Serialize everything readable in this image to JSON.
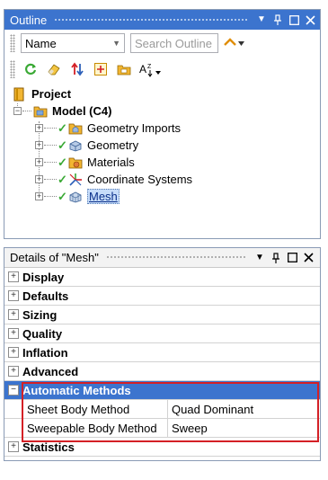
{
  "outline": {
    "title": "Outline",
    "name_filter": "Name",
    "search_placeholder": "Search Outline",
    "tree": [
      {
        "label": "Project",
        "icon": "project-icon",
        "bold": true
      },
      {
        "label": "Model (C4)",
        "icon": "model-icon",
        "bold": true
      },
      {
        "label": "Geometry Imports",
        "icon": "geometry-imports-icon"
      },
      {
        "label": "Geometry",
        "icon": "geometry-icon"
      },
      {
        "label": "Materials",
        "icon": "materials-icon"
      },
      {
        "label": "Coordinate Systems",
        "icon": "coordinate-systems-icon"
      },
      {
        "label": "Mesh",
        "icon": "mesh-icon",
        "selected": true
      }
    ]
  },
  "details": {
    "title": "Details of \"Mesh\"",
    "groups": [
      {
        "label": "Display",
        "expanded": false
      },
      {
        "label": "Defaults",
        "expanded": false
      },
      {
        "label": "Sizing",
        "expanded": false
      },
      {
        "label": "Quality",
        "expanded": false
      },
      {
        "label": "Inflation",
        "expanded": false
      },
      {
        "label": "Advanced",
        "expanded": false
      },
      {
        "label": "Automatic Methods",
        "expanded": true,
        "rows": [
          {
            "name": "Sheet Body Method",
            "value": "Quad Dominant"
          },
          {
            "name": "Sweepable Body Method",
            "value": "Sweep"
          }
        ]
      },
      {
        "label": "Statistics",
        "expanded": false
      }
    ]
  },
  "colors": {
    "accent": "#3c74ce",
    "highlight_border": "#d42026",
    "check": "#3aa935"
  }
}
